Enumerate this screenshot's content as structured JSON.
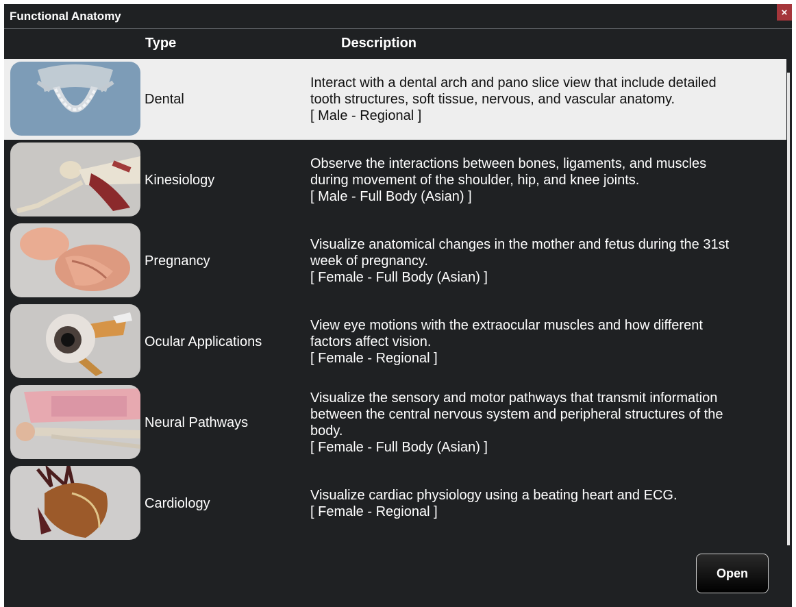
{
  "window": {
    "title": "Functional Anatomy",
    "close_glyph": "×"
  },
  "columns": {
    "type": "Type",
    "description": "Description"
  },
  "rows": [
    {
      "type": "Dental",
      "description": [
        "Interact with a dental arch and pano slice view that include detailed",
        "tooth structures, soft tissue, nervous, and vascular anatomy.",
        "[ Male - Regional ]"
      ],
      "icon": "dental-arch-thumbnail"
    },
    {
      "type": "Kinesiology",
      "description": [
        "Observe the interactions between bones, ligaments, and muscles",
        "during movement of the shoulder, hip, and knee joints.",
        "[ Male - Full Body (Asian) ]"
      ],
      "icon": "skeleton-muscles-thumbnail"
    },
    {
      "type": "Pregnancy",
      "description": [
        "Visualize anatomical changes in the mother and fetus during the 31st",
        "week of pregnancy.",
        "[ Female - Full Body (Asian) ]"
      ],
      "icon": "fetus-thumbnail"
    },
    {
      "type": "Ocular Applications",
      "description": [
        "View eye motions with the extraocular muscles and how different",
        "factors affect vision.",
        "[ Female - Regional ]"
      ],
      "icon": "eyeball-thumbnail"
    },
    {
      "type": "Neural Pathways",
      "description": [
        "Visualize the sensory and motor pathways that transmit information",
        "between the central nervous system and peripheral structures of the",
        "body.",
        "[ Female - Full Body (Asian) ]"
      ],
      "icon": "neural-skeleton-thumbnail"
    },
    {
      "type": "Cardiology",
      "description": [
        "Visualize cardiac physiology using a beating heart and ECG.",
        "[ Female - Regional ]"
      ],
      "icon": "heart-thumbnail"
    }
  ],
  "selected_row": "Dental",
  "footer": {
    "open_label": "Open"
  },
  "colors": {
    "background": "#1f2123",
    "selected_row": "#eeeeee",
    "close_button": "#a5363b"
  }
}
